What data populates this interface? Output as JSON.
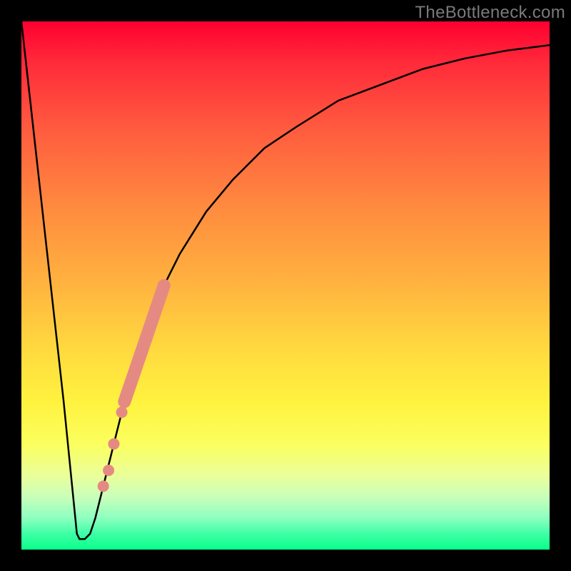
{
  "watermark": "TheBottleneck.com",
  "chart_data": {
    "type": "line",
    "title": "",
    "xlabel": "",
    "ylabel": "",
    "xlim": [
      0,
      100
    ],
    "ylim": [
      0,
      100
    ],
    "grid": false,
    "legend": false,
    "background": {
      "gradient_stops": [
        {
          "pos": 0,
          "color": "#ff0030"
        },
        {
          "pos": 20,
          "color": "#ff5a3f"
        },
        {
          "pos": 50,
          "color": "#ffb43f"
        },
        {
          "pos": 72,
          "color": "#fff23f"
        },
        {
          "pos": 90,
          "color": "#c9ffba"
        },
        {
          "pos": 100,
          "color": "#0aff8a"
        }
      ]
    },
    "series": [
      {
        "name": "curve",
        "color": "#000000",
        "stroke_width": 2,
        "x": [
          0,
          2,
          4,
          6,
          8,
          10,
          10.5,
          11,
          12,
          13,
          14,
          16,
          18,
          20,
          23,
          26,
          30,
          35,
          40,
          46,
          52,
          60,
          68,
          76,
          84,
          92,
          100
        ],
        "y": [
          100,
          82,
          64,
          46,
          28,
          8,
          3,
          2,
          2,
          3,
          6,
          14,
          22,
          30,
          40,
          48,
          56,
          64,
          70,
          76,
          80,
          85,
          88,
          91,
          93,
          94.5,
          95.5
        ]
      }
    ],
    "highlight_segment": {
      "name": "dots",
      "color": "#e58a82",
      "stroke_width": 12,
      "linecap": "round",
      "points": [
        {
          "x": 15.5,
          "y": 12,
          "r": 6
        },
        {
          "x": 16.5,
          "y": 15,
          "r": 6
        },
        {
          "x": 17.5,
          "y": 20,
          "r": 6
        },
        {
          "x": 19.0,
          "y": 26,
          "r": 6
        }
      ],
      "bar_from": {
        "x": 19.5,
        "y": 28
      },
      "bar_to": {
        "x": 27.0,
        "y": 50
      }
    }
  }
}
